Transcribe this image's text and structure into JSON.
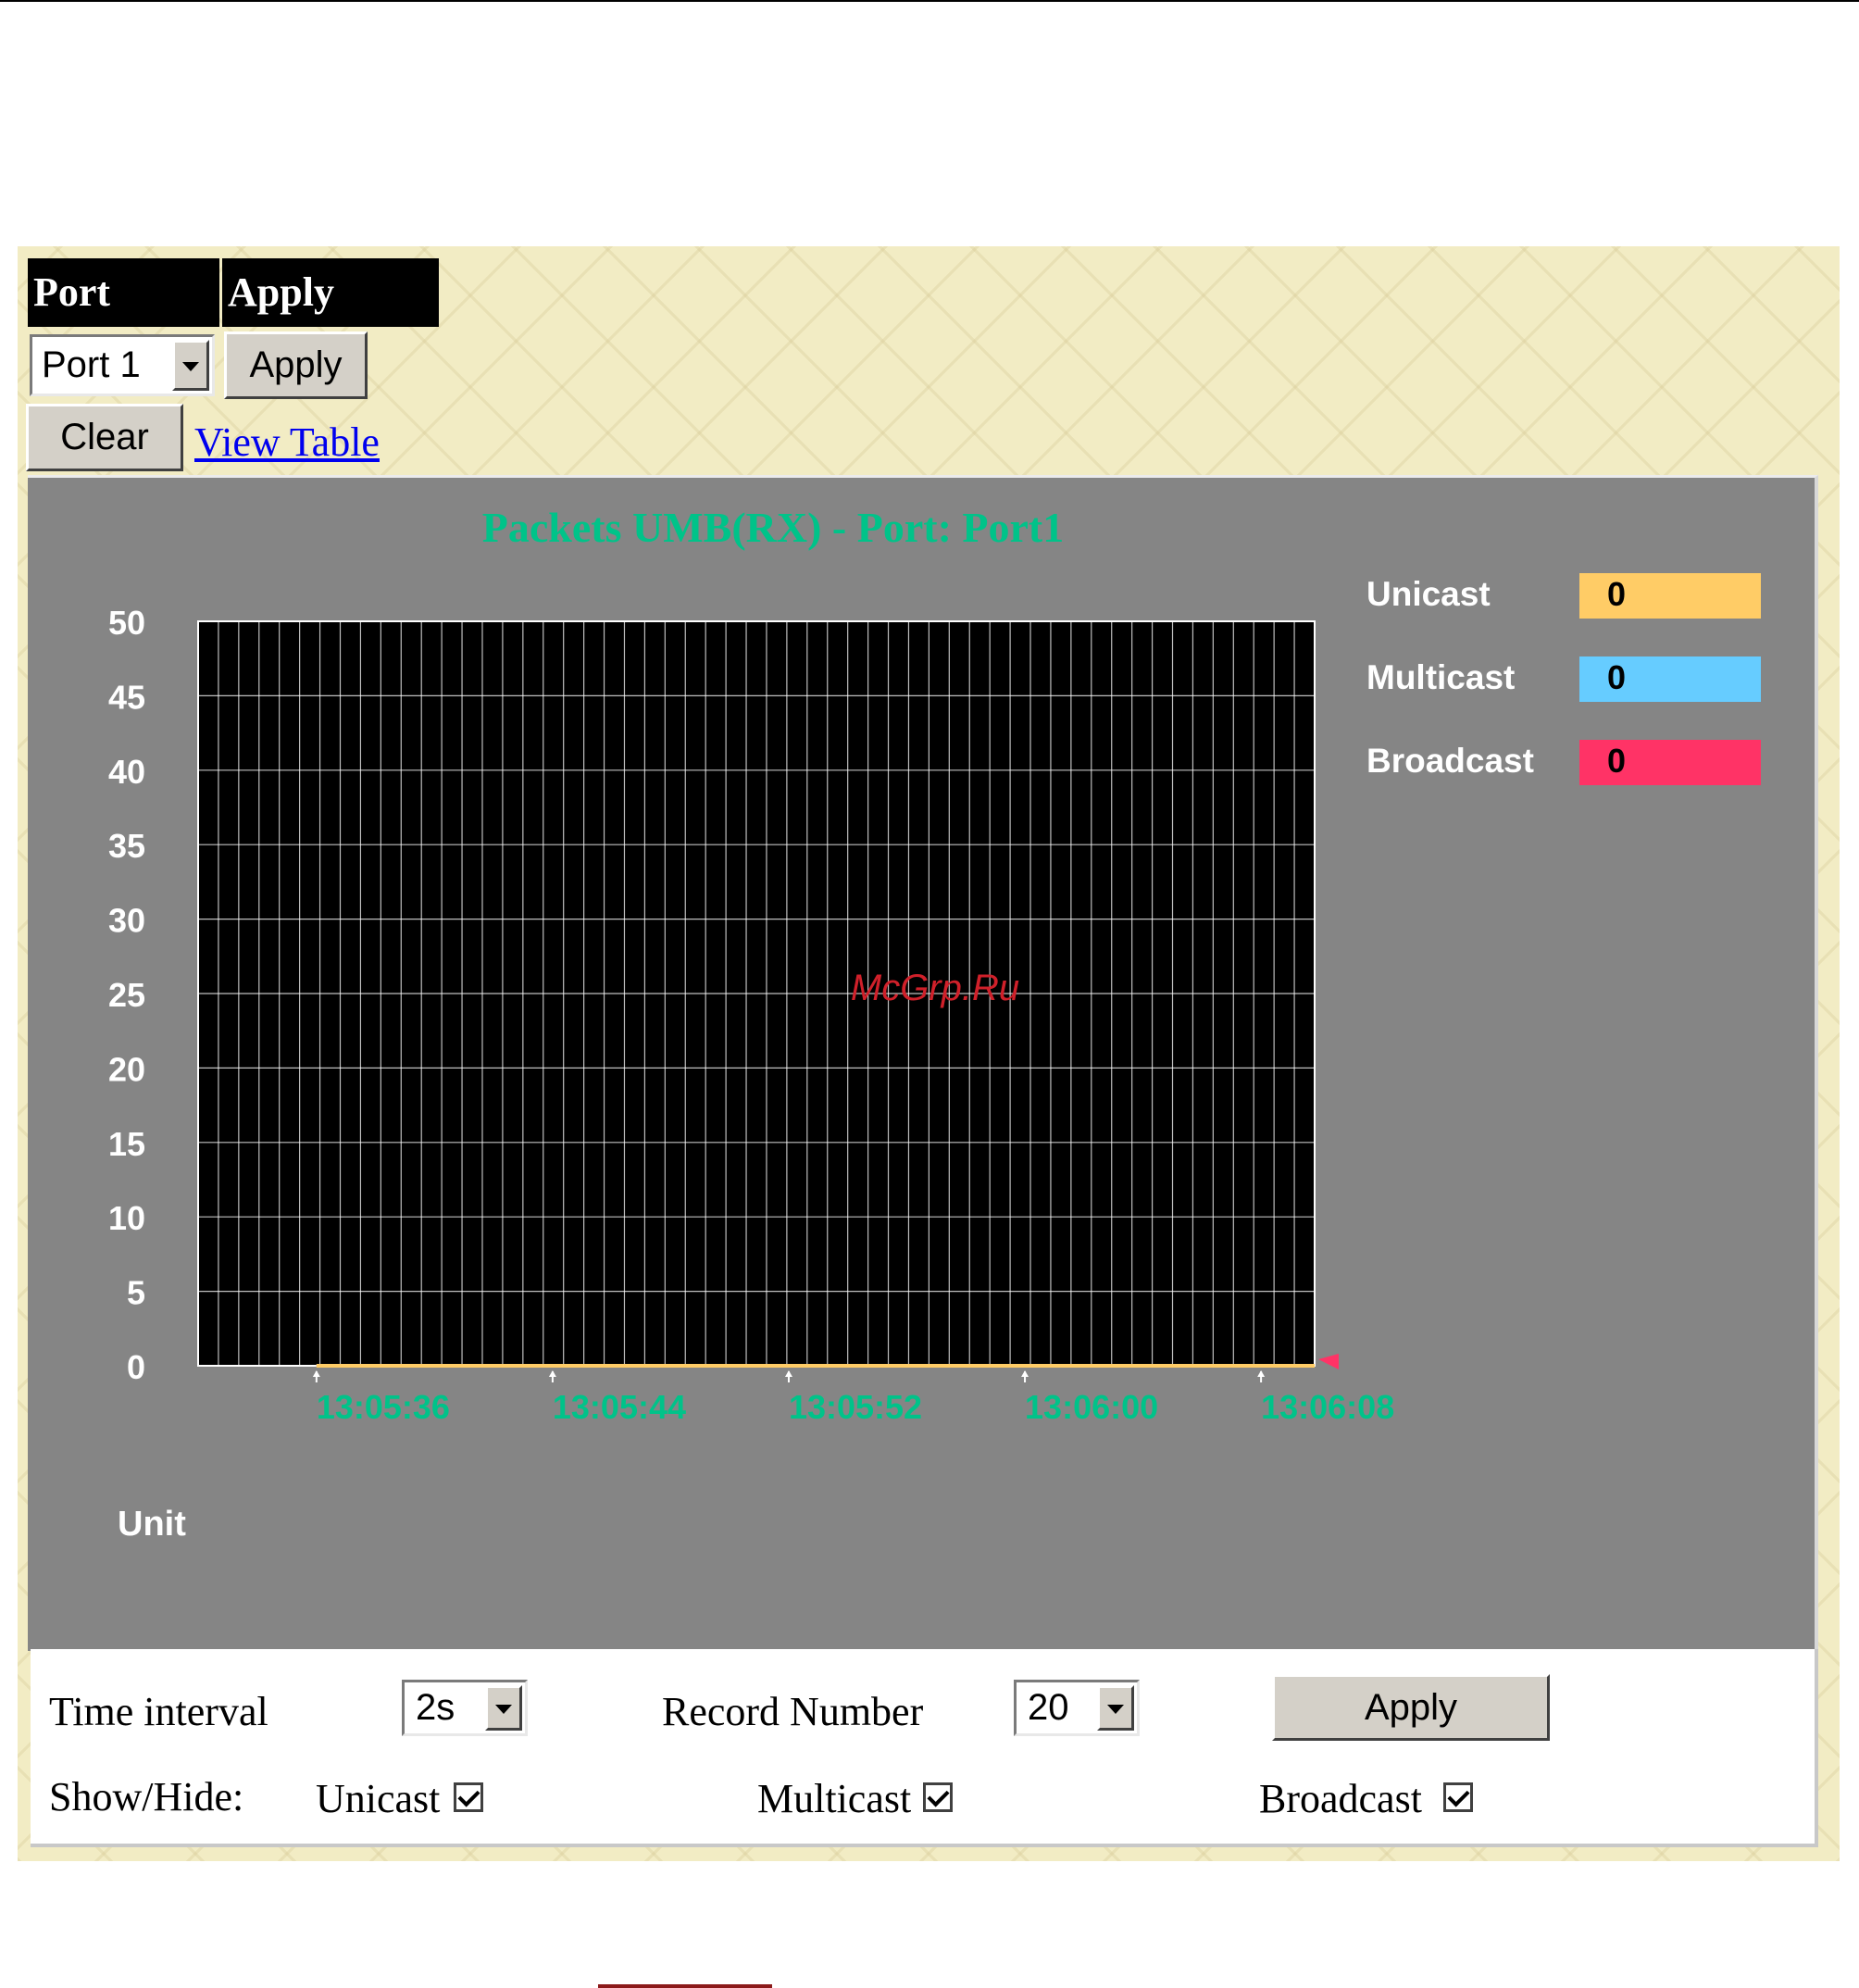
{
  "header": {
    "port_label": "Port",
    "apply_label": "Apply"
  },
  "port_select": {
    "value": "Port 1"
  },
  "buttons": {
    "apply": "Apply",
    "clear": "Clear"
  },
  "links": {
    "view_table": "View Table"
  },
  "chart_data": {
    "type": "line",
    "title": "Packets UMB(RX) - Port: Port1",
    "ylabel": "Unit",
    "xlabel": "",
    "ylim": [
      0,
      50
    ],
    "yticks": [
      0,
      5,
      10,
      15,
      20,
      25,
      30,
      35,
      40,
      45,
      50
    ],
    "xticks": [
      "13:05:36",
      "13:05:44",
      "13:05:52",
      "13:06:00",
      "13:06:08"
    ],
    "grid": true,
    "legend_position": "right",
    "series": [
      {
        "name": "Unicast",
        "color": "#ffcc66",
        "current": "0",
        "values": [
          0,
          0,
          0,
          0,
          0
        ]
      },
      {
        "name": "Multicast",
        "color": "#66ccff",
        "current": "0",
        "values": [
          0,
          0,
          0,
          0,
          0
        ]
      },
      {
        "name": "Broadcast",
        "color": "#ff3366",
        "current": "0",
        "values": [
          0,
          0,
          0,
          0,
          0
        ]
      }
    ],
    "colors": {
      "background": "#858585",
      "plot": "#000000",
      "grid": "#ffffff",
      "text": "#ffffff",
      "accent": "#00c389"
    }
  },
  "controls": {
    "time_interval_label": "Time interval",
    "time_interval_value": "2s",
    "record_number_label": "Record Number",
    "record_number_value": "20",
    "apply_label": "Apply",
    "show_hide_label": "Show/Hide:",
    "checkboxes": [
      {
        "label": "Unicast",
        "checked": true
      },
      {
        "label": "Multicast",
        "checked": true
      },
      {
        "label": "Broadcast",
        "checked": true
      }
    ]
  },
  "watermark": "McGrp.Ru"
}
